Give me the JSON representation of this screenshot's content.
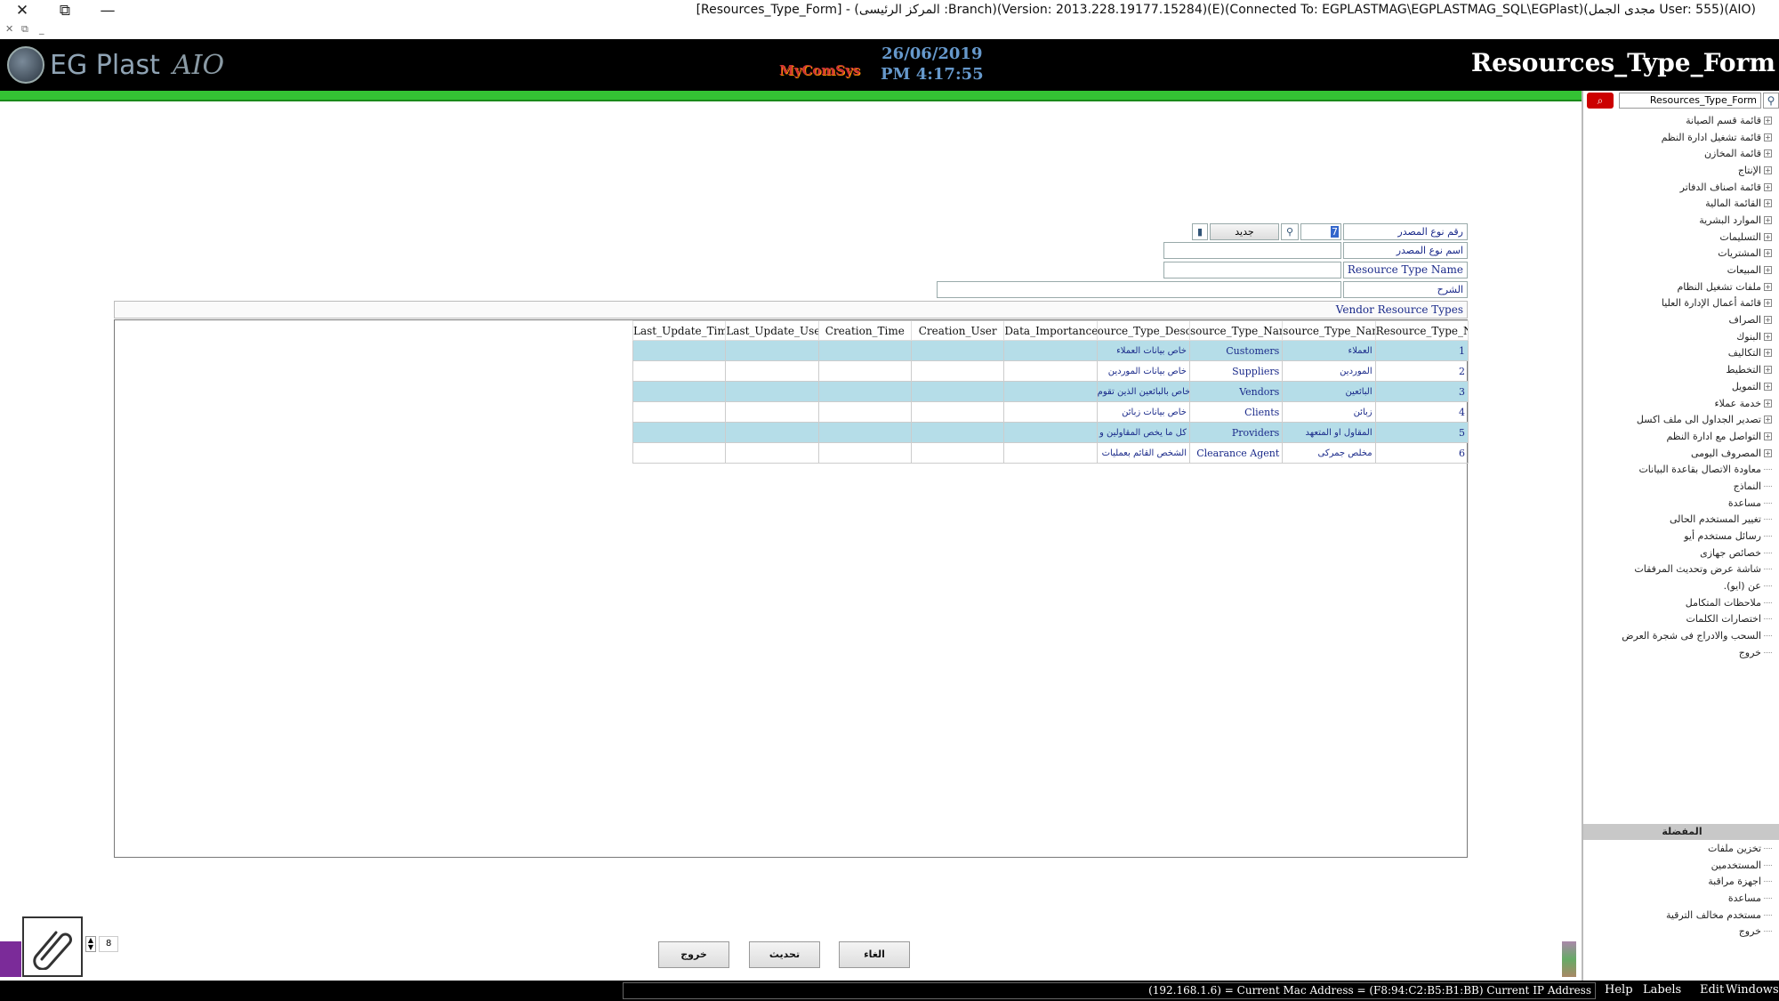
{
  "window": {
    "title": "[Resources_Type_Form] - (المركز الرئيسى :Branch)(Version: 2013.228.19177.15284)(E)(Connected To: EGPLASTMAG\\EGPLASTMAG_SQL\\EGPlast)(مجدى الجمل User: 555)(AIO)",
    "close_glyph": "✕",
    "restore_glyph": "⧉",
    "minimize_glyph": "—",
    "mini_close": "✕",
    "mini_restore": "⧉",
    "mini_min": "_"
  },
  "header": {
    "logo_text": "EG Plast",
    "logo_suffix": "AIO",
    "brand2": "MyComSys",
    "date": "26/06/2019",
    "time": "PM 4:17:55",
    "form_title": "Resources_Type_Form"
  },
  "side": {
    "search_value": "Resources_Type_Form",
    "search_icon": "🔍",
    "tree": [
      {
        "label": "قائمة قسم الصيانة",
        "expand": true
      },
      {
        "label": "قائمة تشغيل ادارة النظم",
        "expand": true
      },
      {
        "label": "قائمة المخازن",
        "expand": true
      },
      {
        "label": "الإنتاج",
        "expand": true
      },
      {
        "label": "قائمة اصناف الدفاتر",
        "expand": true
      },
      {
        "label": "القائمة المالية",
        "expand": true
      },
      {
        "label": "الموارد البشرية",
        "expand": true
      },
      {
        "label": "التسليمات",
        "expand": true
      },
      {
        "label": "المشتريات",
        "expand": true
      },
      {
        "label": "المبيعات",
        "expand": true
      },
      {
        "label": "ملفات تشغيل النظام",
        "expand": true
      },
      {
        "label": "قائمة أعمال الإدارة العليا",
        "expand": true
      },
      {
        "label": "الصراف",
        "expand": true
      },
      {
        "label": "البنوك",
        "expand": true
      },
      {
        "label": "التكاليف",
        "expand": true
      },
      {
        "label": "التخطيط",
        "expand": true
      },
      {
        "label": "التمويل",
        "expand": true
      },
      {
        "label": "خدمة عملاء",
        "expand": true
      },
      {
        "label": "تصدير الجداول الى ملف اكسل",
        "expand": true
      },
      {
        "label": "التواصل مع ادارة النظم",
        "expand": true
      },
      {
        "label": "المصروف اليومى",
        "expand": true
      },
      {
        "label": "معاودة الاتصال بقاعدة البيانات",
        "expand": false
      },
      {
        "label": "النماذج",
        "expand": false
      },
      {
        "label": "مساعدة",
        "expand": false
      },
      {
        "label": "تغيير المستخدم الحالى",
        "expand": false
      },
      {
        "label": "رسائل مستخدم أيو",
        "expand": false
      },
      {
        "label": "خصائص جهازى",
        "expand": false
      },
      {
        "label": "شاشة عرض وتحديث المرفقات",
        "expand": false
      },
      {
        "label": "عن (ايو).",
        "expand": false
      },
      {
        "label": "ملاحظات المتكامل",
        "expand": false
      },
      {
        "label": "اختصارات الكلمات",
        "expand": false
      },
      {
        "label": "السحب والادراج فى شجرة العرض",
        "expand": false
      },
      {
        "label": "خروج",
        "expand": false
      }
    ],
    "section2_title": "المفضلة",
    "tree2": [
      "تخزين ملفات",
      "المستخدمين",
      "اجهزة مراقبة",
      "مساعدة",
      "مستخدم مخالف الترقية",
      "خروج"
    ]
  },
  "form": {
    "source_no_label": "رقم نوع المصدر",
    "source_no_value": "7",
    "new_label": "جديد",
    "source_name_label": "اسم نوع المصدر",
    "resource_type_name_label": "Resource Type Name",
    "desc_label": "الشرح",
    "grid_caption": "Vendor Resource Types"
  },
  "grid": {
    "columns": [
      "Last_Update_Time",
      "Last_Update_User",
      "Creation_Time",
      "Creation_User",
      "Data_Importance",
      "ource_Type_Descrip",
      "source_Type_Name_",
      "source_Type_Name_",
      "Resource_Type_No"
    ],
    "rows": [
      {
        "no": "1",
        "name_ar": "العملاء",
        "name_en": "Customers",
        "desc": "خاص بيانات العملاء"
      },
      {
        "no": "2",
        "name_ar": "الموردين",
        "name_en": "Suppliers",
        "desc": "خاص بيانات الموردين"
      },
      {
        "no": "3",
        "name_ar": "البائعين",
        "name_en": "Vendors",
        "desc": "خاص بالبائعين الذين تقوم"
      },
      {
        "no": "4",
        "name_ar": "زبائن",
        "name_en": "Clients",
        "desc": "خاص بيانات زبائن"
      },
      {
        "no": "5",
        "name_ar": "المقاول او المتعهد",
        "name_en": "Providers",
        "desc": "كل ما يخص المقاولين و"
      },
      {
        "no": "6",
        "name_ar": "مخلص جمركى",
        "name_en": "Clearance Agent",
        "desc": "الشخص القائم بعمليات"
      }
    ]
  },
  "buttons": {
    "exit": "خروج",
    "refresh": "تحديث",
    "cancel": "الغاء"
  },
  "spinner_value": "8",
  "status": {
    "ip_text": "(192.168.1.6) = Current Mac Address = (F8:94:C2:B5:B1:BB) Current IP Address",
    "menu_help": "Help",
    "menu_labels": "Labels",
    "menu_edit": "Edit",
    "menu_windows": "Windows"
  }
}
